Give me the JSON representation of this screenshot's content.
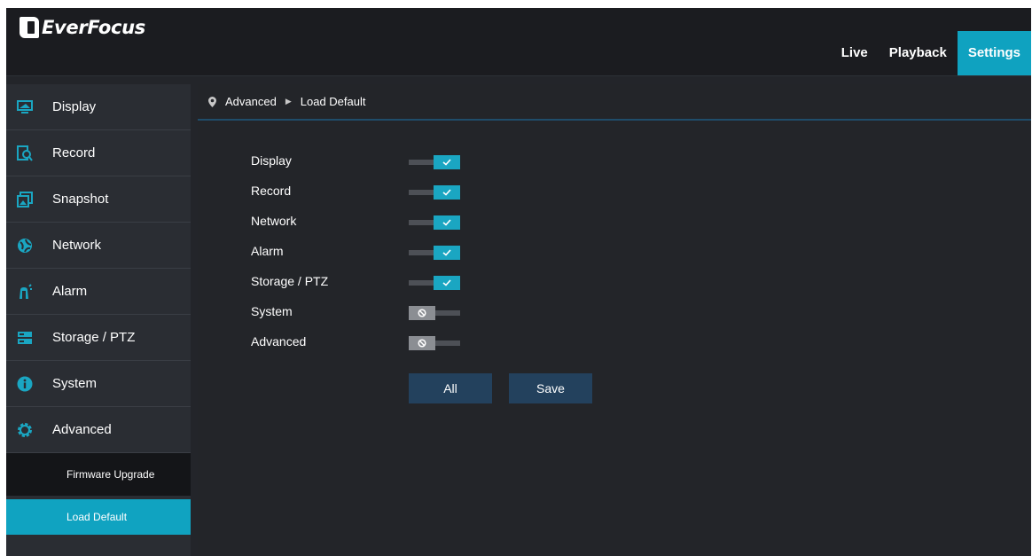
{
  "brand": {
    "name": "EverFocus"
  },
  "nav": {
    "items": [
      {
        "label": "Live",
        "active": false
      },
      {
        "label": "Playback",
        "active": false
      },
      {
        "label": "Settings",
        "active": true
      }
    ]
  },
  "sidebar": {
    "items": [
      {
        "label": "Display",
        "icon": "monitor-icon"
      },
      {
        "label": "Record",
        "icon": "record-icon"
      },
      {
        "label": "Snapshot",
        "icon": "snapshot-icon"
      },
      {
        "label": "Network",
        "icon": "network-icon"
      },
      {
        "label": "Alarm",
        "icon": "alarm-icon"
      },
      {
        "label": "Storage / PTZ",
        "icon": "storage-icon"
      },
      {
        "label": "System",
        "icon": "info-icon"
      },
      {
        "label": "Advanced",
        "icon": "gear-icon"
      }
    ],
    "subitems": [
      {
        "label": "Firmware Upgrade",
        "active": false
      },
      {
        "label": "Load Default",
        "active": true
      }
    ]
  },
  "breadcrumb": {
    "section": "Advanced",
    "page": "Load Default"
  },
  "options": [
    {
      "label": "Display",
      "enabled": true
    },
    {
      "label": "Record",
      "enabled": true
    },
    {
      "label": "Network",
      "enabled": true
    },
    {
      "label": "Alarm",
      "enabled": true
    },
    {
      "label": "Storage / PTZ",
      "enabled": true
    },
    {
      "label": "System",
      "enabled": false
    },
    {
      "label": "Advanced",
      "enabled": false
    }
  ],
  "buttons": {
    "all": "All",
    "save": "Save"
  },
  "colors": {
    "accent": "#0fa2c0",
    "button": "#23415d",
    "background": "#23252a"
  }
}
